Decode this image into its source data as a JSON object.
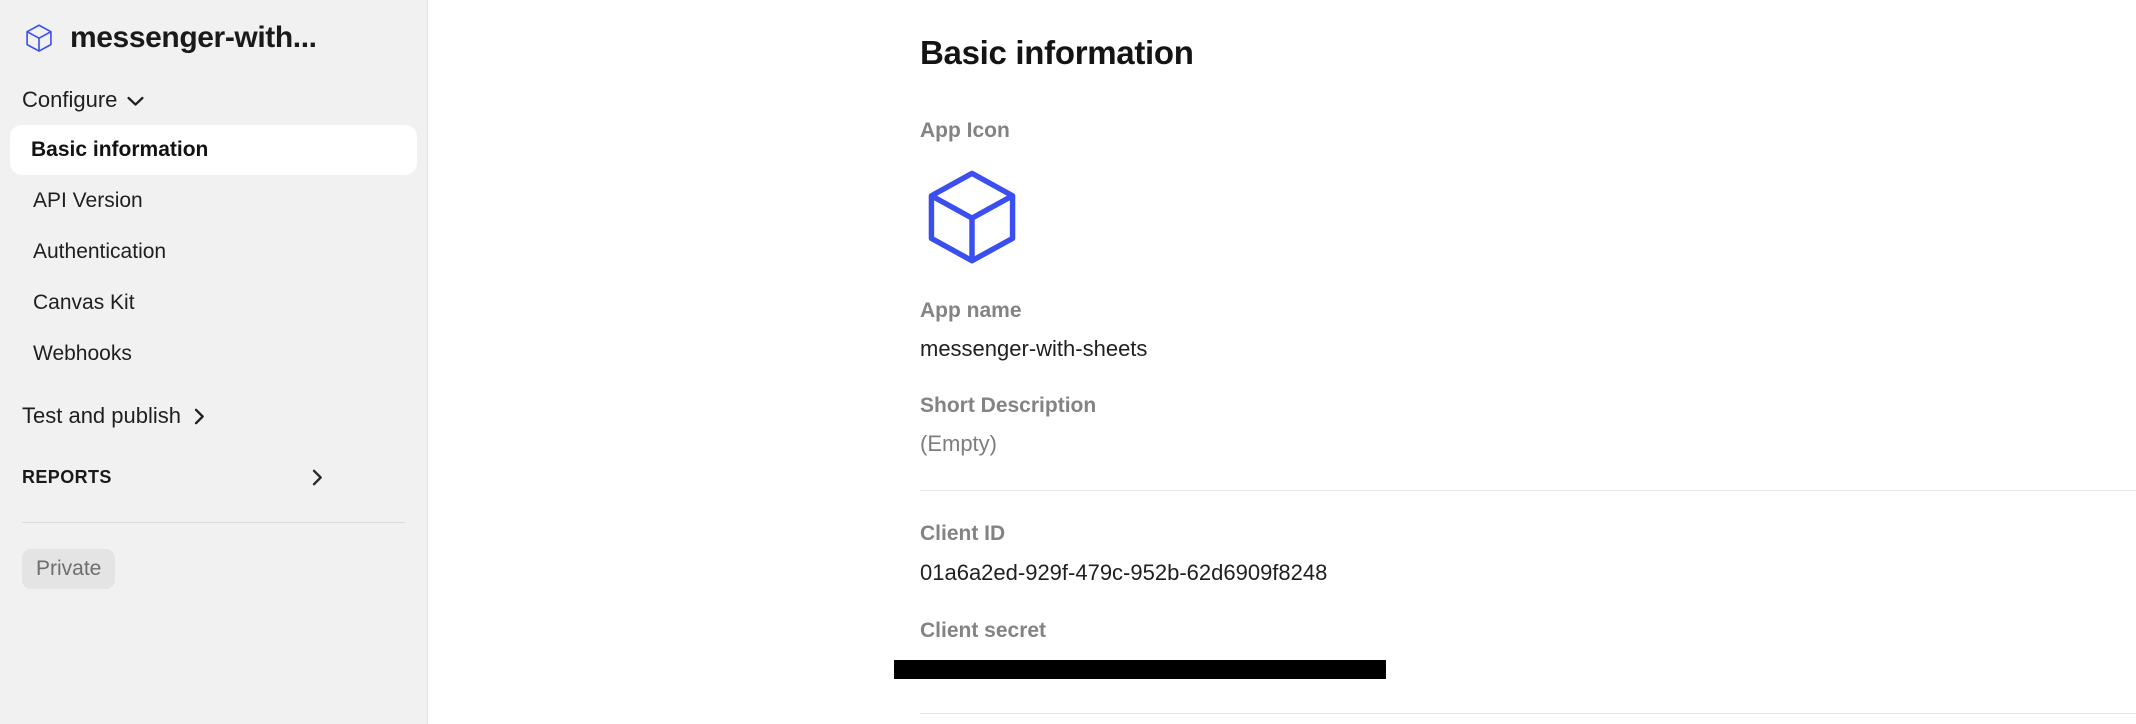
{
  "sidebar": {
    "logo_icon": "cube-icon",
    "title": "messenger-with...",
    "configure": {
      "label": "Configure",
      "chevron_icon": "chevron-down-icon"
    },
    "nav_items": [
      {
        "label": "Basic information",
        "active": true
      },
      {
        "label": "API Version",
        "active": false
      },
      {
        "label": "Authentication",
        "active": false
      },
      {
        "label": "Canvas Kit",
        "active": false
      },
      {
        "label": "Webhooks",
        "active": false
      }
    ],
    "test_and_publish": {
      "label": "Test and publish",
      "chevron_icon": "chevron-right-icon"
    },
    "reports": {
      "label": "REPORTS",
      "chevron_icon": "chevron-right-icon"
    },
    "visibility_badge": "Private"
  },
  "main": {
    "page_title": "Basic information",
    "fields": {
      "app_icon": {
        "label": "App Icon",
        "icon": "cube-icon",
        "color": "#3b4ef0"
      },
      "app_name": {
        "label": "App name",
        "value": "messenger-with-sheets"
      },
      "short_description": {
        "label": "Short Description",
        "value": "(Empty)"
      },
      "client_id": {
        "label": "Client ID",
        "value": "01a6a2ed-929f-479c-952b-62d6909f8248"
      },
      "client_secret": {
        "label": "Client secret",
        "value": ""
      }
    }
  },
  "colors": {
    "accent_blue": "#3b4ef0",
    "sidebar_bg": "#f1f1f1",
    "label_gray": "#838383",
    "text_dark": "#1f1f1f"
  }
}
